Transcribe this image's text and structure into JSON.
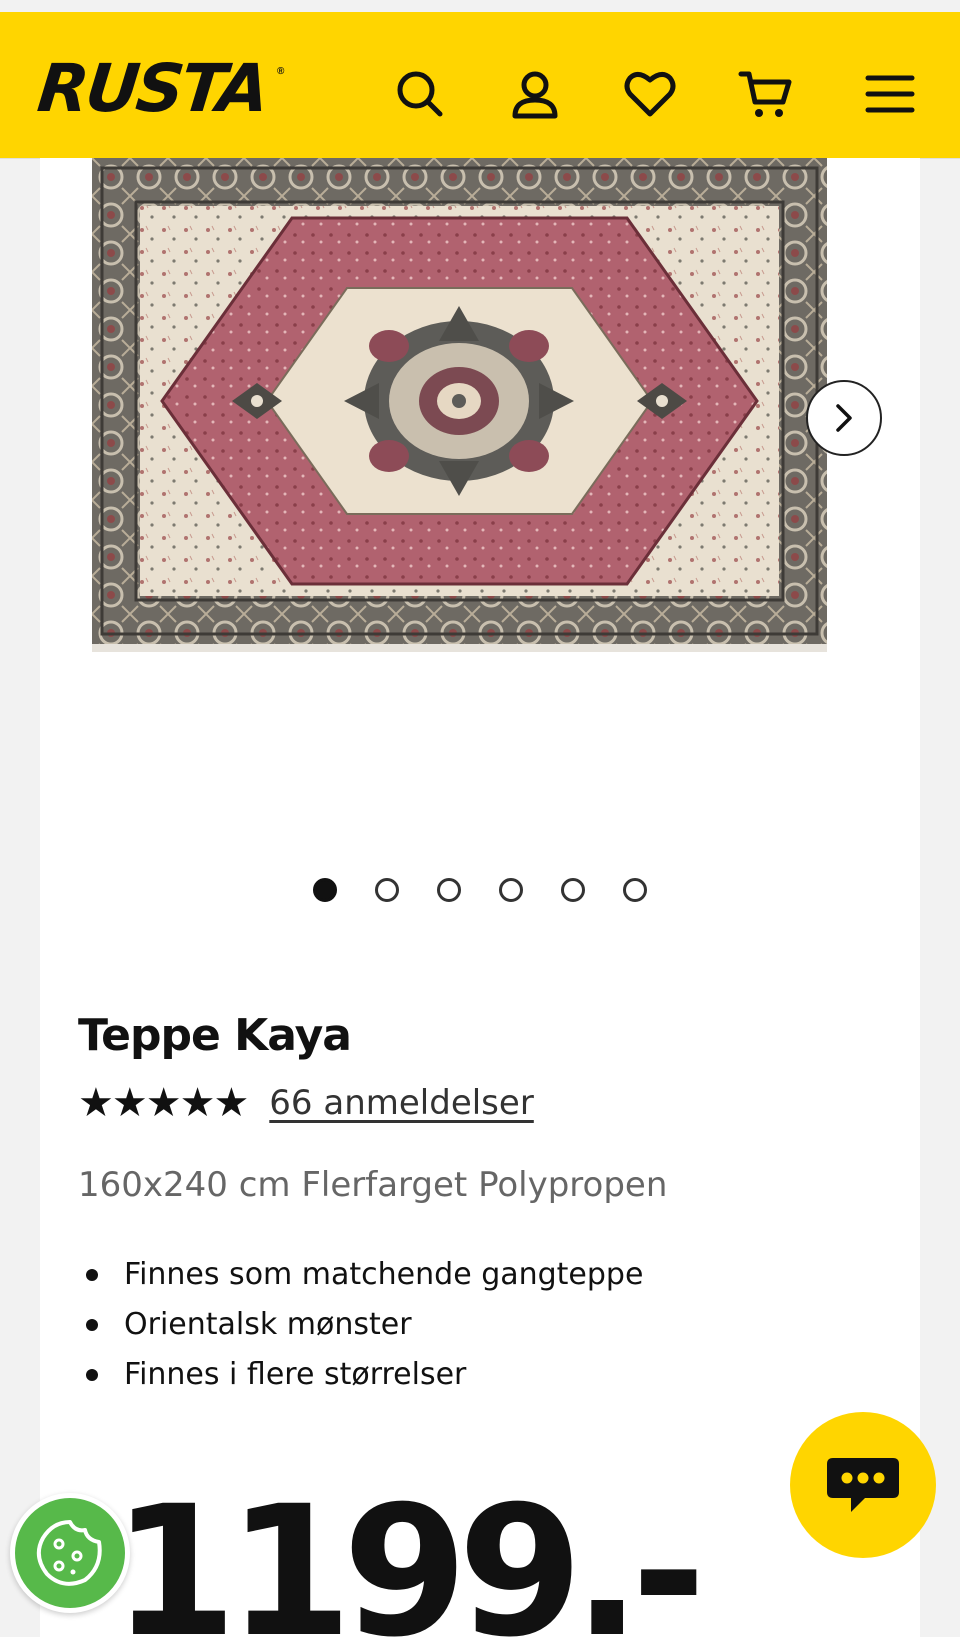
{
  "header": {
    "brand": "RUSTA",
    "brand_mark": "®",
    "icons": [
      "search-icon",
      "account-icon",
      "heart-icon",
      "cart-icon",
      "menu-icon"
    ],
    "background_color": "#ffd500"
  },
  "gallery": {
    "image_alt": "Teppe Kaya",
    "total_images": 6,
    "active_index": 0,
    "next_icon": "chevron-right-icon"
  },
  "product": {
    "title": "Teppe Kaya",
    "rating": 5,
    "rating_stars": "★★★★★",
    "reviews_label": "66 anmeldelser",
    "subtitle": "160x240 cm Flerfarget Polypropen",
    "features": [
      "Finnes som matchende gangteppe",
      "Orientalsk mønster",
      "Finnes i flere størrelser"
    ],
    "price": "1199.-"
  },
  "widgets": {
    "chat_icon": "chat-bubble-icon",
    "chat_color": "#ffd500",
    "cookie_icon": "cookie-icon",
    "cookie_color": "#57b94a"
  }
}
